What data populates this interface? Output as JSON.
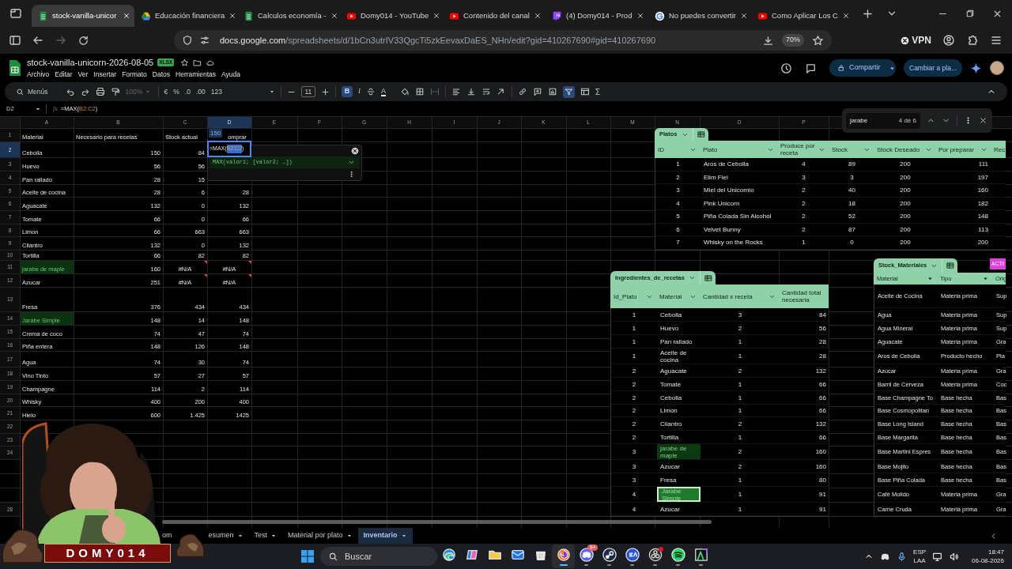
{
  "browser": {
    "tabs": [
      {
        "kind": "sheets",
        "title": "stock-vanilla-unicor",
        "selected": true
      },
      {
        "kind": "drive",
        "title": "Educación financiera",
        "selected": false
      },
      {
        "kind": "sheets",
        "title": "Calculos economía -",
        "selected": false
      },
      {
        "kind": "youtube",
        "title": "Domy014 - YouTube",
        "selected": false
      },
      {
        "kind": "youtube",
        "title": "Contenido del canal",
        "selected": false
      },
      {
        "kind": "twitch",
        "title": "(4) Domy014 - Prod",
        "selected": false
      },
      {
        "kind": "google",
        "title": "No puedes convertir",
        "selected": false
      },
      {
        "kind": "youtube",
        "title": "Como Aplicar Los C",
        "selected": false
      }
    ],
    "url_host": "docs.google.com",
    "url_path": "/spreadsheets/d/1bCn3utrIV33QgcTi5zkEevaxDaES_NHn/edit?gid=410267690#gid=410267690",
    "zoom": "70%",
    "vpn": "VPN"
  },
  "sheet_header": {
    "title": "stock-vanilla-unicorn-2026-08-05",
    "badge": "XLSX",
    "menus": [
      "Archivo",
      "Editar",
      "Ver",
      "Insertar",
      "Formato",
      "Datos",
      "Herramientas",
      "Ayuda"
    ],
    "share": "Compartir",
    "mode": "Cambiar a pla..."
  },
  "toolbar": {
    "menus": "Menús",
    "zoom": "100%",
    "currency": "€",
    "percent": "%",
    "decrease_decimals": ".0",
    "increase_decimals": ".00",
    "number_format": "123",
    "font_size": "11",
    "bold": "B",
    "italic": "I",
    "text_color": "A",
    "functions": "Σ",
    "bold_on": true,
    "filter_on": true
  },
  "formula_bar": {
    "cell": "D2",
    "fx": "fx",
    "function": "=MAX(",
    "range": "B2:C2",
    "close": ")"
  },
  "grid": {
    "columns": [
      {
        "label": "A",
        "selected": false
      },
      {
        "label": "B",
        "selected": false
      },
      {
        "label": "C",
        "selected": false
      },
      {
        "label": "D",
        "selected": true
      },
      {
        "label": "E",
        "selected": false
      },
      {
        "label": "F",
        "selected": false
      },
      {
        "label": "G",
        "selected": false
      },
      {
        "label": "H",
        "selected": false
      },
      {
        "label": "I",
        "selected": false
      },
      {
        "label": "J",
        "selected": false
      },
      {
        "label": "K",
        "selected": false
      },
      {
        "label": "L",
        "selected": false
      },
      {
        "label": "M",
        "selected": false
      },
      {
        "label": "N",
        "selected": false
      },
      {
        "label": "O",
        "selected": false
      },
      {
        "label": "P",
        "selected": false
      }
    ],
    "rows": [
      {
        "number": "1",
        "selected": false,
        "match": false,
        "errors": false,
        "cells": [
          "Material",
          "Necesario para recetas",
          "Stock actual",
          "omprar"
        ]
      },
      {
        "number": "2",
        "selected": true,
        "match": false,
        "errors": false,
        "cells": [
          "Cebolla",
          "150",
          "84"
        ]
      },
      {
        "number": "3",
        "selected": false,
        "match": false,
        "errors": false,
        "cells": [
          "Huevo",
          "56",
          "56"
        ]
      },
      {
        "number": "4",
        "selected": false,
        "match": false,
        "errors": false,
        "cells": [
          "Pan rallado",
          "28",
          "15"
        ]
      },
      {
        "number": "5",
        "selected": false,
        "match": false,
        "errors": false,
        "cells": [
          "Aceite de cocina",
          "28",
          "6",
          "28"
        ]
      },
      {
        "number": "6",
        "selected": false,
        "match": false,
        "errors": false,
        "cells": [
          "Aguacate",
          "132",
          "0",
          "132"
        ]
      },
      {
        "number": "7",
        "selected": false,
        "match": false,
        "errors": false,
        "cells": [
          "Tomate",
          "66",
          "0",
          "66"
        ]
      },
      {
        "number": "8",
        "selected": false,
        "match": false,
        "errors": false,
        "cells": [
          "Limon",
          "66",
          "663",
          "663"
        ]
      },
      {
        "number": "9",
        "selected": false,
        "match": false,
        "errors": false,
        "cells": [
          "Cilantro",
          "132",
          "0",
          "132"
        ]
      },
      {
        "number": "10",
        "selected": false,
        "match": false,
        "errors": false,
        "cells": [
          "Tortilla",
          "66",
          "82",
          "82"
        ]
      },
      {
        "number": "11",
        "selected": false,
        "match": true,
        "errors": true,
        "cells": [
          "jarabe de maple",
          "160",
          "#N/A",
          "#N/A"
        ]
      },
      {
        "number": "12",
        "selected": false,
        "match": false,
        "errors": true,
        "cells": [
          "Azucar",
          "251",
          "#N/A",
          "#N/A"
        ]
      },
      {
        "number": "13",
        "selected": false,
        "match": false,
        "errors": false,
        "cells": [
          "Fresa",
          "376",
          "434",
          "434"
        ]
      },
      {
        "number": "14",
        "selected": false,
        "match": true,
        "errors": false,
        "cells": [
          "Jarabe Simple",
          "148",
          "14",
          "148"
        ]
      },
      {
        "number": "15",
        "selected": false,
        "match": false,
        "errors": false,
        "cells": [
          "Crema de coco",
          "74",
          "47",
          "74"
        ]
      },
      {
        "number": "16",
        "selected": false,
        "match": false,
        "errors": false,
        "cells": [
          "Piña entera",
          "148",
          "126",
          "148"
        ]
      },
      {
        "number": "17",
        "selected": false,
        "match": false,
        "errors": false,
        "cells": [
          "Agua",
          "74",
          "30",
          "74"
        ]
      },
      {
        "number": "18",
        "selected": false,
        "match": false,
        "errors": false,
        "cells": [
          "Vino Tinto",
          "57",
          "27",
          "57"
        ]
      },
      {
        "number": "19",
        "selected": false,
        "match": false,
        "errors": false,
        "cells": [
          "Champagne",
          "114",
          "2",
          "114"
        ]
      },
      {
        "number": "20",
        "selected": false,
        "match": false,
        "errors": false,
        "cells": [
          "Whisky",
          "400",
          "200",
          "400"
        ]
      },
      {
        "number": "21",
        "selected": false,
        "match": false,
        "errors": false,
        "cells": [
          "Hielo",
          "600",
          "1.425",
          "1425"
        ]
      },
      {
        "number": "22",
        "selected": false
      },
      {
        "number": "23",
        "selected": false
      },
      {
        "number": "24",
        "selected": false
      },
      {
        "kind": "covered"
      },
      {
        "kind": "covered"
      },
      {
        "kind": "covered"
      },
      {
        "number": "28",
        "selected": false
      }
    ]
  },
  "editor": {
    "chip": "150",
    "function": "=MAX(",
    "range": "B2:C2",
    "close": ")"
  },
  "autocomplete": {
    "signature": "MAX(valor1; [valor2; …])"
  },
  "find": {
    "query": "jarabe",
    "count": "4 de 6"
  },
  "tables": [
    {
      "name": "Platos",
      "columns": [
        "ID",
        "Plato",
        "Produce por receta",
        "Stock",
        "Stock Deseado",
        "Por preparar",
        "Rec"
      ],
      "rows": [
        {
          "cells": [
            "1",
            "Aros de Cebolla",
            "4",
            "89",
            "200",
            "111"
          ]
        },
        {
          "cells": [
            "2",
            "Elim Fiel",
            "3",
            "3",
            "200",
            "197"
          ]
        },
        {
          "cells": [
            "3",
            "Miel del Unicornio",
            "2",
            "40",
            "200",
            "160"
          ]
        },
        {
          "cells": [
            "4",
            "Pink Unicorn",
            "2",
            "18",
            "200",
            "182"
          ]
        },
        {
          "cells": [
            "5",
            "Piña Colada Sin Alcohol",
            "2",
            "52",
            "200",
            "148"
          ]
        },
        {
          "cells": [
            "6",
            "Velvet Bunny",
            "2",
            "87",
            "200",
            "113"
          ]
        },
        {
          "cells": [
            "7",
            "Whisky on the Rocks",
            "1",
            "0",
            "200",
            "200"
          ]
        }
      ]
    },
    {
      "name": "Ingredientes_de_recetas",
      "columns": [
        "Id_Plato",
        "Material",
        "Cantidad x receta",
        "Cantidad total necesaria"
      ],
      "rows": [
        {
          "cells": [
            "1",
            "Cebolla",
            "3",
            "84"
          ],
          "found": false,
          "current": false
        },
        {
          "cells": [
            "1",
            "Huevo",
            "2",
            "56"
          ],
          "found": false,
          "current": false
        },
        {
          "cells": [
            "1",
            "Pan rallado",
            "1",
            "28"
          ],
          "found": false,
          "current": false
        },
        {
          "cells": [
            "1",
            "Aceite de cocina",
            "1",
            "28"
          ],
          "found": false,
          "current": false
        },
        {
          "cells": [
            "2",
            "Aguacate",
            "2",
            "132"
          ],
          "found": false,
          "current": false
        },
        {
          "cells": [
            "2",
            "Tomate",
            "1",
            "66"
          ],
          "found": false,
          "current": false
        },
        {
          "cells": [
            "2",
            "Cebolla",
            "1",
            "66"
          ],
          "found": false,
          "current": false
        },
        {
          "cells": [
            "2",
            "Limon",
            "1",
            "66"
          ],
          "found": false,
          "current": false
        },
        {
          "cells": [
            "2",
            "Cilantro",
            "2",
            "132"
          ],
          "found": false,
          "current": false
        },
        {
          "cells": [
            "2",
            "Tortilla",
            "1",
            "66"
          ],
          "found": false,
          "current": false
        },
        {
          "cells": [
            "3",
            "jarabe de maple",
            "2",
            "160"
          ],
          "found": true,
          "current": false
        },
        {
          "cells": [
            "3",
            "Azucar",
            "2",
            "160"
          ],
          "found": false,
          "current": false
        },
        {
          "cells": [
            "3",
            "Fresa",
            "1",
            "80"
          ],
          "found": false,
          "current": false
        },
        {
          "cells": [
            "4",
            "Jarabe Simple",
            "1",
            "91"
          ],
          "found": true,
          "current": true
        },
        {
          "cells": [
            "4",
            "Azucar",
            "1",
            "91"
          ],
          "found": false,
          "current": false
        }
      ]
    },
    {
      "name": "Stock_Materiales",
      "badge": "ACTI",
      "columns": [
        "Material",
        "Tipo",
        "Orig"
      ],
      "rows": [
        {
          "cells": [
            "Aceite de Cocina",
            "Materia prima",
            "Sup"
          ]
        },
        {
          "cells": [
            "Agua",
            "Materia prima",
            "Sup"
          ]
        },
        {
          "cells": [
            "Agua Mineral",
            "Materia prima",
            "Sup"
          ]
        },
        {
          "cells": [
            "Aguacate",
            "Materia prima",
            "Gra"
          ]
        },
        {
          "cells": [
            "Aros de Cebolla",
            "Producto hecho",
            "Pla"
          ]
        },
        {
          "cells": [
            "Azúcar",
            "Materia prima",
            "Gra"
          ]
        },
        {
          "cells": [
            "Barril de Cerveza",
            "Materia prima",
            "Coc"
          ]
        },
        {
          "cells": [
            "Base Champagne To",
            "Base hecha",
            "Bas"
          ]
        },
        {
          "cells": [
            "Base Cosmopolitan",
            "Base hecha",
            "Bas"
          ]
        },
        {
          "cells": [
            "Base Long Island",
            "Base hecha",
            "Bas"
          ]
        },
        {
          "cells": [
            "Base Margarita",
            "Base hecha",
            "Bas"
          ]
        },
        {
          "cells": [
            "Base Martini Espres",
            "Base hecha",
            "Bas"
          ]
        },
        {
          "cells": [
            "Base Mojito",
            "Base hecha",
            "Bas"
          ]
        },
        {
          "cells": [
            "Base Piña Colada",
            "Base hecha",
            "Bas"
          ]
        },
        {
          "cells": [
            "Café Molido",
            "Materia prima",
            "Gra"
          ]
        },
        {
          "cells": [
            "Carne Cruda",
            "Materia prima",
            "Gra"
          ]
        }
      ]
    }
  ],
  "sheet_tabs": [
    {
      "label": "om",
      "selected": false
    },
    {
      "label": "esumen",
      "selected": false
    },
    {
      "label": "Test",
      "selected": false
    },
    {
      "label": "Material por plato",
      "selected": false
    },
    {
      "label": "Inventario",
      "selected": true
    }
  ],
  "streamer": {
    "name": "DOMY014"
  },
  "taskbar": {
    "search": "Buscar",
    "apps": [
      {
        "kind": "edge",
        "running": false,
        "active": false
      },
      {
        "kind": "copilot",
        "running": false,
        "active": false
      },
      {
        "kind": "files",
        "running": false,
        "active": false
      },
      {
        "kind": "mail",
        "running": false,
        "active": false
      },
      {
        "kind": "store",
        "running": false,
        "active": false
      },
      {
        "kind": "firefox",
        "running": true,
        "active": true
      },
      {
        "kind": "discord",
        "running": true,
        "active": false,
        "badge": "9+"
      },
      {
        "kind": "steam",
        "running": true,
        "active": false
      },
      {
        "kind": "ea",
        "running": true,
        "active": false
      },
      {
        "kind": "obs",
        "running": true,
        "active": false,
        "alert": true
      },
      {
        "kind": "spotify",
        "running": true,
        "active": false
      },
      {
        "kind": "app",
        "running": true,
        "active": false
      }
    ],
    "language": "ESP",
    "layout": "LAA",
    "time": "18:47",
    "date": "06-08-2026"
  }
}
